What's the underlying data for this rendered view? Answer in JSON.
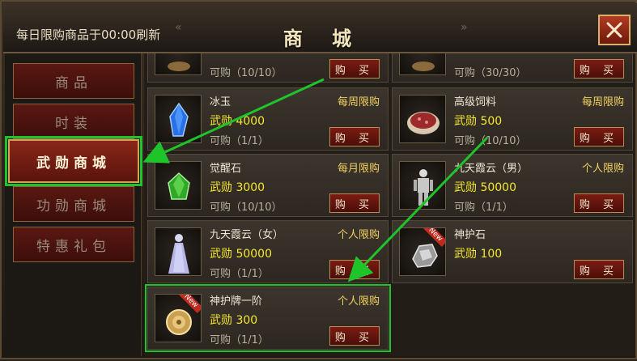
{
  "header": {
    "notice": "每日限购商品于00:00刷新",
    "title": "商 城",
    "deco_left": "«",
    "deco_right": "»"
  },
  "nav": {
    "items": [
      {
        "label": "商品",
        "active": false
      },
      {
        "label": "时装",
        "active": false
      },
      {
        "label": "武勋商城",
        "active": true
      },
      {
        "label": "功勋商城",
        "active": false
      },
      {
        "label": "特惠礼包",
        "active": false
      }
    ]
  },
  "shop": {
    "buy_label": "购 买",
    "items": [
      {
        "name": "",
        "limit": "",
        "price": "",
        "qty": "可购（10/10）",
        "icon": "ore-icon"
      },
      {
        "name": "",
        "limit": "",
        "price": "",
        "qty": "可购（30/30）",
        "icon": "ore-icon"
      },
      {
        "name": "冰玉",
        "limit": "每周限购",
        "price": "武勋 4000",
        "qty": "可购（1/1）",
        "icon": "blue-crystal-icon"
      },
      {
        "name": "高级饲料",
        "limit": "每周限购",
        "price": "武勋 500",
        "qty": "可购（10/10）",
        "icon": "feed-icon"
      },
      {
        "name": "觉醒石",
        "limit": "每月限购",
        "price": "武勋 3000",
        "qty": "可购（10/10）",
        "icon": "green-gem-icon"
      },
      {
        "name": "九天霞云（男）",
        "limit": "个人限购",
        "price": "武勋 50000",
        "qty": "可购（1/1）",
        "icon": "armor-male-icon"
      },
      {
        "name": "九天霞云（女）",
        "limit": "个人限购",
        "price": "武勋 50000",
        "qty": "可购（1/1）",
        "icon": "armor-female-icon"
      },
      {
        "name": "神护石",
        "limit": "",
        "price": "武勋 100",
        "qty": "",
        "icon": "guard-stone-icon",
        "new": "New"
      },
      {
        "name": "神护牌一阶",
        "limit": "个人限购",
        "price": "武勋 300",
        "qty": "可购（1/1）",
        "icon": "amulet-icon",
        "new": "New"
      }
    ]
  },
  "colors": {
    "accent_green": "#1fc42a",
    "price_yellow": "#f6e62f",
    "limit_gold": "#f2d060",
    "button_red": "#7b1c12"
  }
}
